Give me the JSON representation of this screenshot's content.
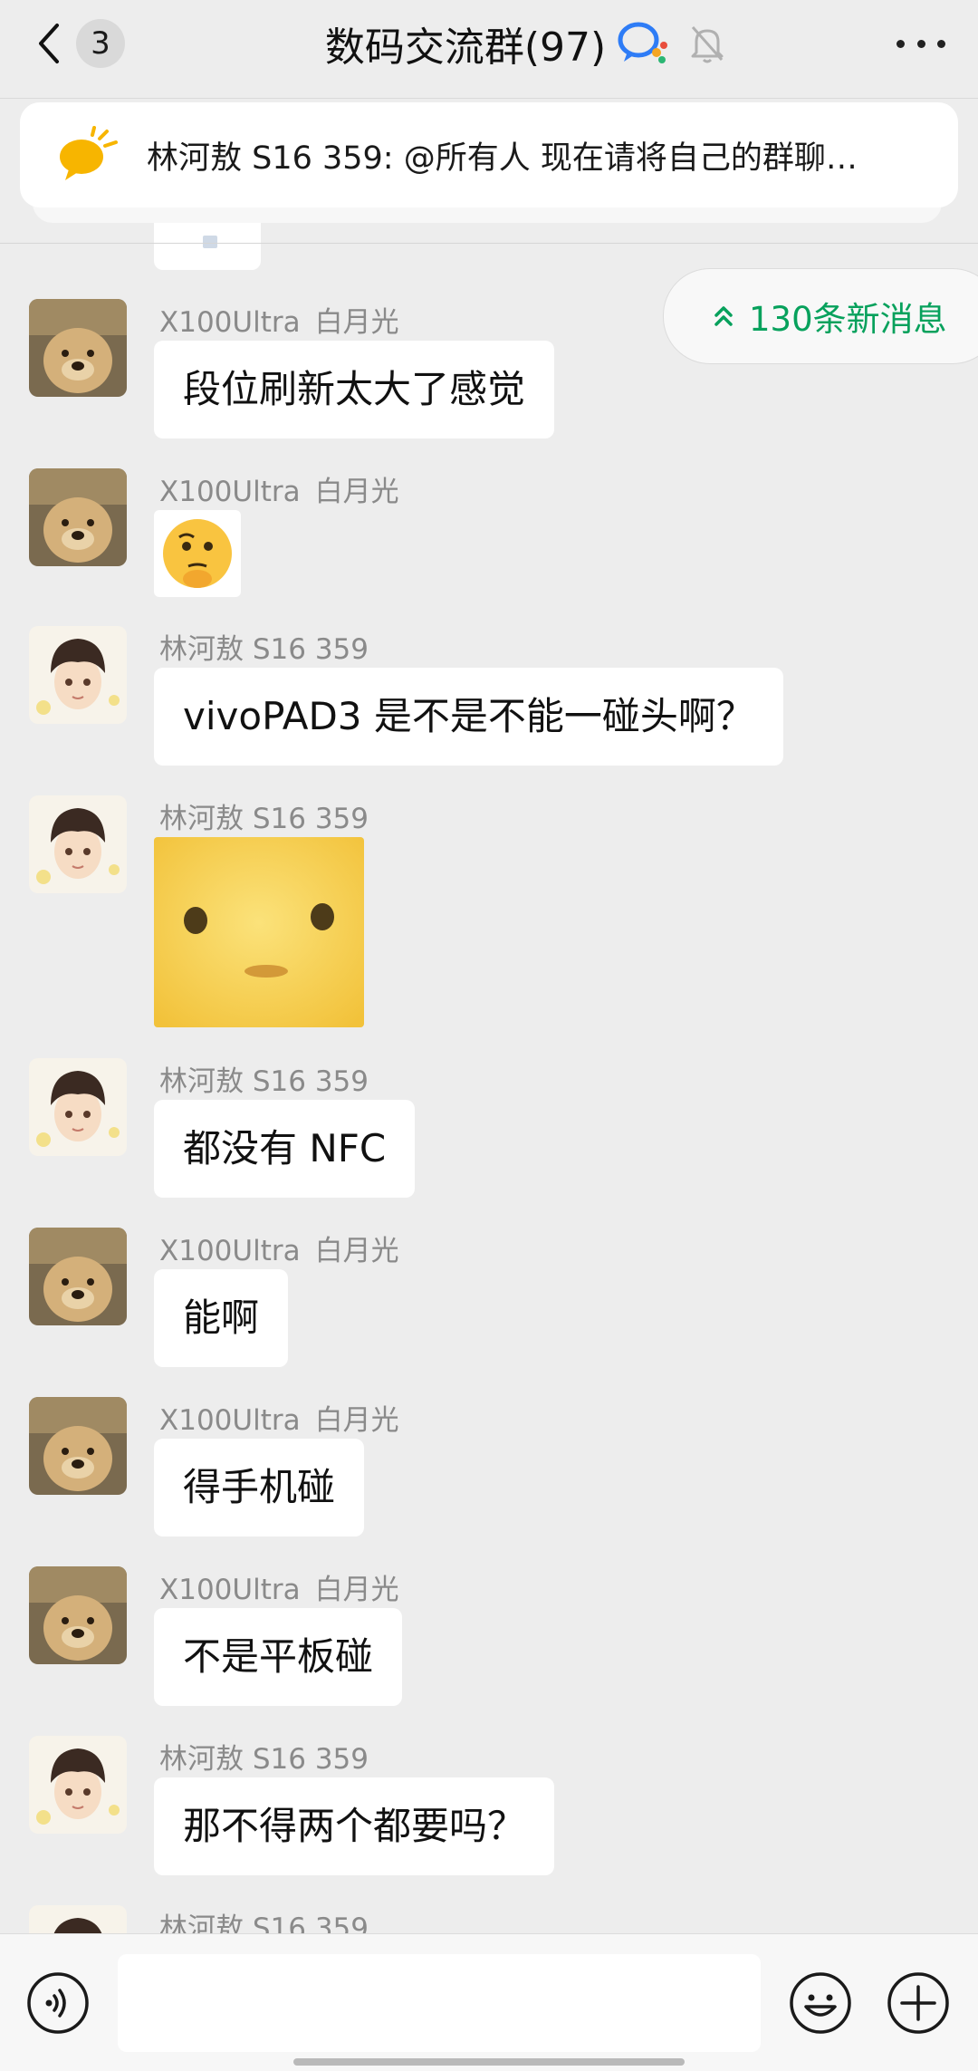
{
  "header": {
    "unread_count": "3",
    "title": "数码交流群(97)",
    "icons": [
      "back-chevron-icon",
      "group-chat-icon",
      "mute-bell-icon",
      "more-dots-icon"
    ]
  },
  "announcement": {
    "text": "林河敖 S16 359: @所有人 现在请将自己的群聊…",
    "icon": "megaphone-icon"
  },
  "new_messages": {
    "label": "130条新消息",
    "icon": "double-chevron-up-icon",
    "color": "#07a15c"
  },
  "messages": [
    {
      "sender": "X100Ultra",
      "tag": "白月光",
      "type": "text",
      "text": "段位刷新太大了感觉",
      "avatar": "dog-avatar"
    },
    {
      "sender": "X100Ultra",
      "tag": "白月光",
      "type": "emoji",
      "emoji": "🫡",
      "avatar": "dog-avatar"
    },
    {
      "sender": "林河敖 S16 359",
      "tag": "",
      "type": "text",
      "text": "vivoPAD3 是不是不能一碰头啊？",
      "avatar": "boy-avatar"
    },
    {
      "sender": "林河敖 S16 359",
      "tag": "",
      "type": "sticker",
      "avatar": "boy-avatar"
    },
    {
      "sender": "林河敖 S16 359",
      "tag": "",
      "type": "text",
      "text": "都没有 NFC",
      "avatar": "boy-avatar"
    },
    {
      "sender": "X100Ultra",
      "tag": "白月光",
      "type": "text",
      "text": "能啊",
      "avatar": "dog-avatar"
    },
    {
      "sender": "X100Ultra",
      "tag": "白月光",
      "type": "text",
      "text": "得手机碰",
      "avatar": "dog-avatar"
    },
    {
      "sender": "X100Ultra",
      "tag": "白月光",
      "type": "text",
      "text": "不是平板碰",
      "avatar": "dog-avatar"
    },
    {
      "sender": "林河敖 S16 359",
      "tag": "",
      "type": "text",
      "text": "那不得两个都要吗？",
      "avatar": "boy-avatar"
    },
    {
      "sender": "林河敖 S16 359",
      "tag": "",
      "type": "partial",
      "avatar": "boy-avatar"
    }
  ],
  "input": {
    "value": "",
    "placeholder": ""
  },
  "colors": {
    "background": "#ededed",
    "bubble": "#ffffff",
    "accent_green": "#07a15c"
  }
}
